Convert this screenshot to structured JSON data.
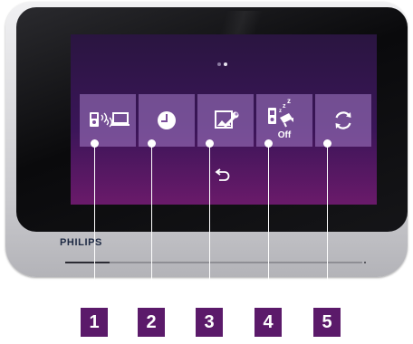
{
  "colors": {
    "screen_top": "#2a1540",
    "screen_bottom": "#6a1a6a",
    "tile": "#a57dc8",
    "callout_box": "#5b1a6a",
    "bezel": "#111114",
    "housing": "#d6d6da"
  },
  "screen": {
    "page_indicator": {
      "pages": 2,
      "current": 2
    },
    "tiles": [
      {
        "number": "1",
        "icon": "intercom-transfer-to-monitor-icon",
        "label": ""
      },
      {
        "number": "2",
        "icon": "clock-icon",
        "label": ""
      },
      {
        "number": "3",
        "icon": "settings-image-wrench-icon",
        "label": ""
      },
      {
        "number": "4",
        "icon": "do-not-disturb-camera-icon",
        "label": "Off"
      },
      {
        "number": "5",
        "icon": "refresh-icon",
        "label": ""
      }
    ],
    "back_icon": "back-arrow-icon"
  },
  "device": {
    "brand": "PHILIPS",
    "slider_level": 0.15
  },
  "callouts": [
    "1",
    "2",
    "3",
    "4",
    "5"
  ]
}
